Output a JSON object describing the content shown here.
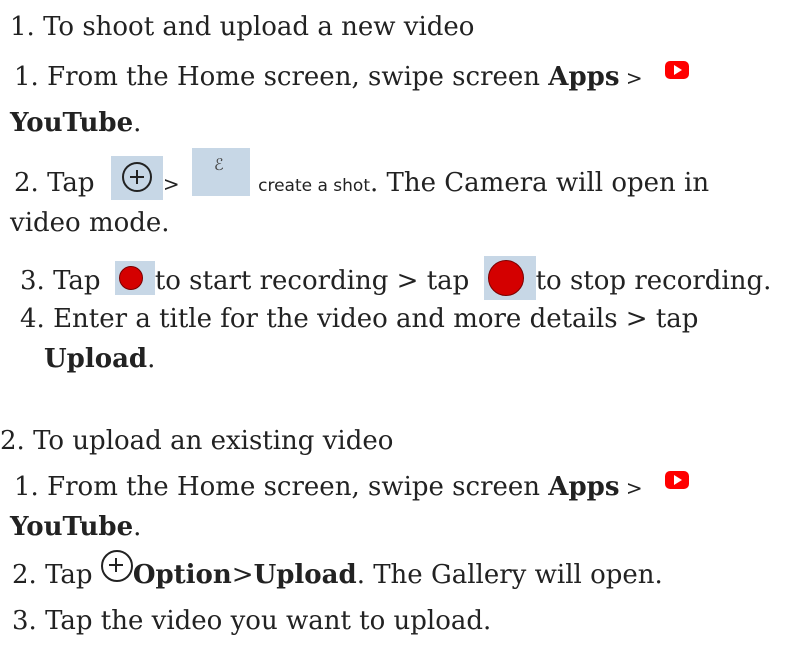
{
  "section1": {
    "heading": "1. To shoot and upload a new video",
    "step1": {
      "prefix": "1. From the Home screen, swipe screen ",
      "apps": "Apps",
      "sep": " >",
      "youtube": "YouTube",
      "end": "."
    },
    "step2": {
      "prefix": "2. Tap",
      "sep": ">",
      "create": "create a shot",
      "rest": ". The Camera will open in",
      "rest2": "video mode."
    },
    "step3": {
      "prefix": "3. Tap",
      "start": "to start recording > tap",
      "stop": "to stop recording."
    },
    "step4": {
      "text": "4. Enter a title for the video and more details > tap",
      "upload": "Upload",
      "end": "."
    }
  },
  "section2": {
    "heading": "2. To upload an existing video",
    "step1": {
      "prefix": "1. From the Home screen, swipe screen ",
      "apps": "Apps",
      "sep": " >",
      "youtube": "YouTube",
      "end": "."
    },
    "step2": {
      "prefix": "2. Tap",
      "option": "Option",
      "gt": ">",
      "upload": "Upload",
      "rest": ". The Gallery will open."
    },
    "step3": {
      "text": "3. Tap the video you want to upload."
    }
  },
  "icons": [
    "youtube-icon",
    "plus-circle-icon",
    "shorts-icon",
    "record-icon"
  ],
  "colors": {
    "record": "#d40000",
    "youtube": "#ff0000",
    "tile": "#c7d7e6"
  }
}
